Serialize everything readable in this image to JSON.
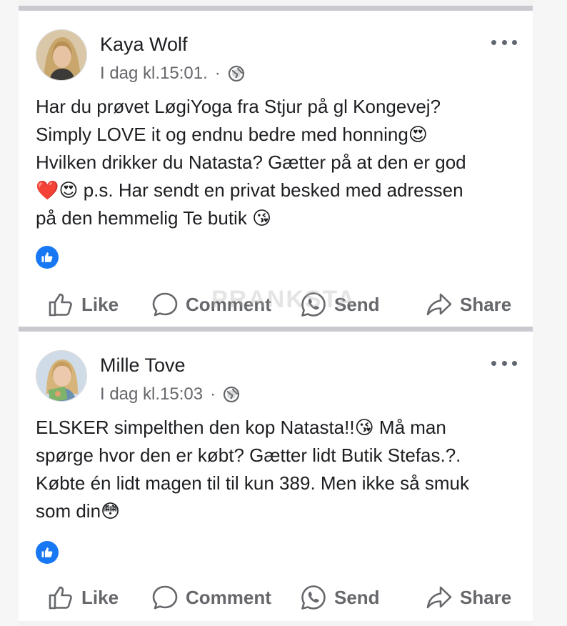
{
  "posts": [
    {
      "author": "Kaya Wolf",
      "time": "I dag kl.15:01.",
      "separator": "·",
      "lines": [
        "Har du prøvet LøgiYoga fra Stjur på gl Kongevej?",
        "Simply LOVE it og endnu bedre med honning😍",
        "Hvilken drikker du Natasta? Gætter på at den er god",
        "❤️😍 p.s. Har sendt en privat besked med adressen",
        "på den hemmelig Te butik 😘"
      ],
      "reaction_icon": "like-icon"
    },
    {
      "author": "Mille Tove",
      "time": "I dag kl.15:03",
      "separator": "·",
      "lines": [
        "ELSKER simpelthen den kop Natasta!!😘 Må man",
        "spørge hvor den er købt? Gætter lidt Butik Stefas.?.",
        "Købte én lidt magen til til kun 389. Men ikke så smuk",
        "som din😳"
      ],
      "reaction_icon": "like-icon"
    }
  ],
  "actions": {
    "like": "Like",
    "comment": "Comment",
    "send": "Send",
    "share": "Share"
  },
  "watermark": "PRANKSTA",
  "colors": {
    "accent": "#1877f2",
    "text": "#1c1e21",
    "muted": "#65676b",
    "divider": "#c9cacf"
  }
}
